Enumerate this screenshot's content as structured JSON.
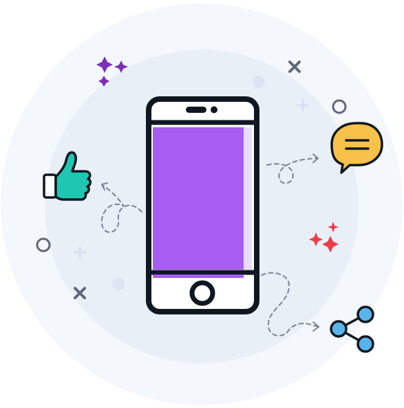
{
  "illustration": {
    "subject": "smartphone-social-engagement",
    "icons": [
      "phone-icon",
      "thumbs-up-icon",
      "chat-bubble-icon",
      "share-icon",
      "sparkle-icon",
      "dashed-arrow-icon"
    ]
  },
  "colors": {
    "outer_circle": "#f4f7fb",
    "inner_circle": "#e9eff6",
    "outline": "#0f1720",
    "phone_body": "#ffffff",
    "phone_screen": "#a75cf2",
    "screen_highlight": "#e6ddf8",
    "thumbs_up": "#1fc7b3",
    "chat_bubble": "#f8c14a",
    "share_nodes": "#5ab4ec",
    "sparkle_purple": "#7e2fb8",
    "sparkle_red": "#ef3b48",
    "deco_gray": "#5f6678",
    "deco_light": "#d9dff0",
    "dashed_lines": "#7a8396"
  }
}
